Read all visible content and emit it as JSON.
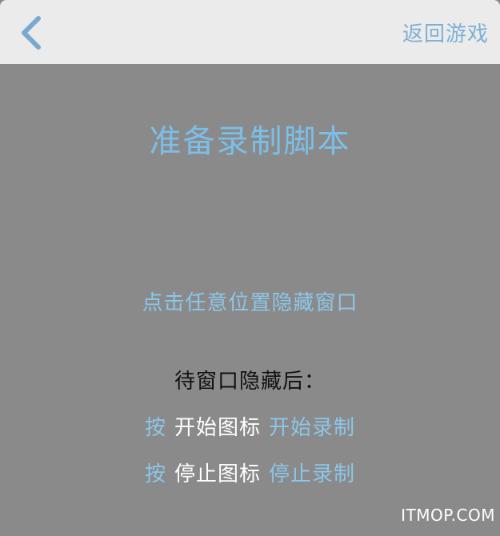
{
  "header": {
    "back_icon": "chevron-left-icon",
    "return_label": "返回游戏"
  },
  "main": {
    "title": "准备录制脚本",
    "hint": "点击任意位置隐藏窗口",
    "after_hidden": "待窗口隐藏后：",
    "step_start": {
      "press": "按",
      "icon_label": "开始图标",
      "action": "开始录制"
    },
    "step_stop": {
      "press": "按",
      "icon_label": "停止图标",
      "action": "停止录制"
    }
  },
  "watermark": "ITMOP.COM",
  "colors": {
    "overlay": "#8a8a8a",
    "header_bg": "#ebebeb",
    "accent_blue": "#7bbfe8",
    "back_icon": "#7aa9cf"
  }
}
